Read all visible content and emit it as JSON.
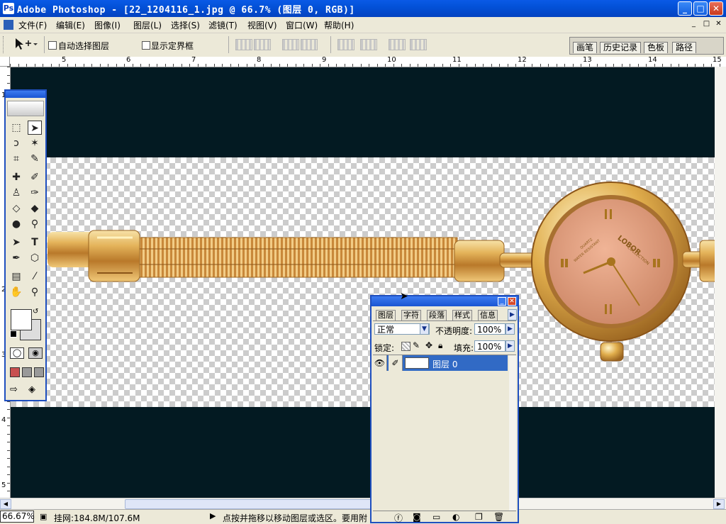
{
  "window": {
    "title": "Adobe Photoshop - [22_1204116_1.jpg @ 66.7% (图层 0, RGB)]",
    "app_icon": "photoshop-icon",
    "minimize_symbol": "_",
    "maximize_symbol": "□",
    "close_symbol": "✕"
  },
  "menu": {
    "items": [
      "文件(F)",
      "编辑(E)",
      "图像(I)",
      "图层(L)",
      "选择(S)",
      "滤镜(T)",
      "视图(V)",
      "窗口(W)",
      "帮助(H)"
    ],
    "doc_controls": [
      "_",
      "□",
      "✕"
    ]
  },
  "options": {
    "tool_icon": "move-tool-icon",
    "auto_select_label": "自动选择图层",
    "show_bounds_label": "显示定界框",
    "auto_select_checked": false,
    "show_bounds_checked": false
  },
  "palette_well": {
    "tabs": [
      "画笔",
      "历史记录",
      "色板",
      "路径"
    ]
  },
  "ruler": {
    "h_labels": [
      "5",
      "6",
      "7",
      "8",
      "9",
      "10",
      "11",
      "12",
      "13",
      "14",
      "15"
    ],
    "v_labels": [
      "1",
      "2",
      "3",
      "4",
      "5"
    ]
  },
  "colors": {
    "canvas_bg": "#031a22",
    "title_blue": "#0351d8",
    "watch_gold": "#c89a3a",
    "dial_pink": "#d8967a"
  },
  "watch": {
    "brand": "LOBOR",
    "sub": "COLLECTION",
    "dial_small": "QUARTZ",
    "dial_small2": "WATER RESISTANT"
  },
  "layers_panel": {
    "tabs": [
      "图层",
      "字符",
      "段落",
      "样式",
      "信息"
    ],
    "active_tab": "图层",
    "blend_mode": "正常",
    "opacity_label": "不透明度:",
    "opacity_value": "100%",
    "lock_label": "锁定:",
    "fill_label": "填充:",
    "fill_value": "100%",
    "layer_name": "图层 0",
    "footer_icons": [
      "layer-style-icon",
      "mask-icon",
      "new-set-icon",
      "adjustment-icon",
      "new-layer-icon",
      "trash-icon"
    ]
  },
  "status": {
    "zoom": "66.67%",
    "doc_size": "挂网:184.8M/107.6M",
    "hint": "点按并拖移以移动图层或选区。要用附"
  }
}
